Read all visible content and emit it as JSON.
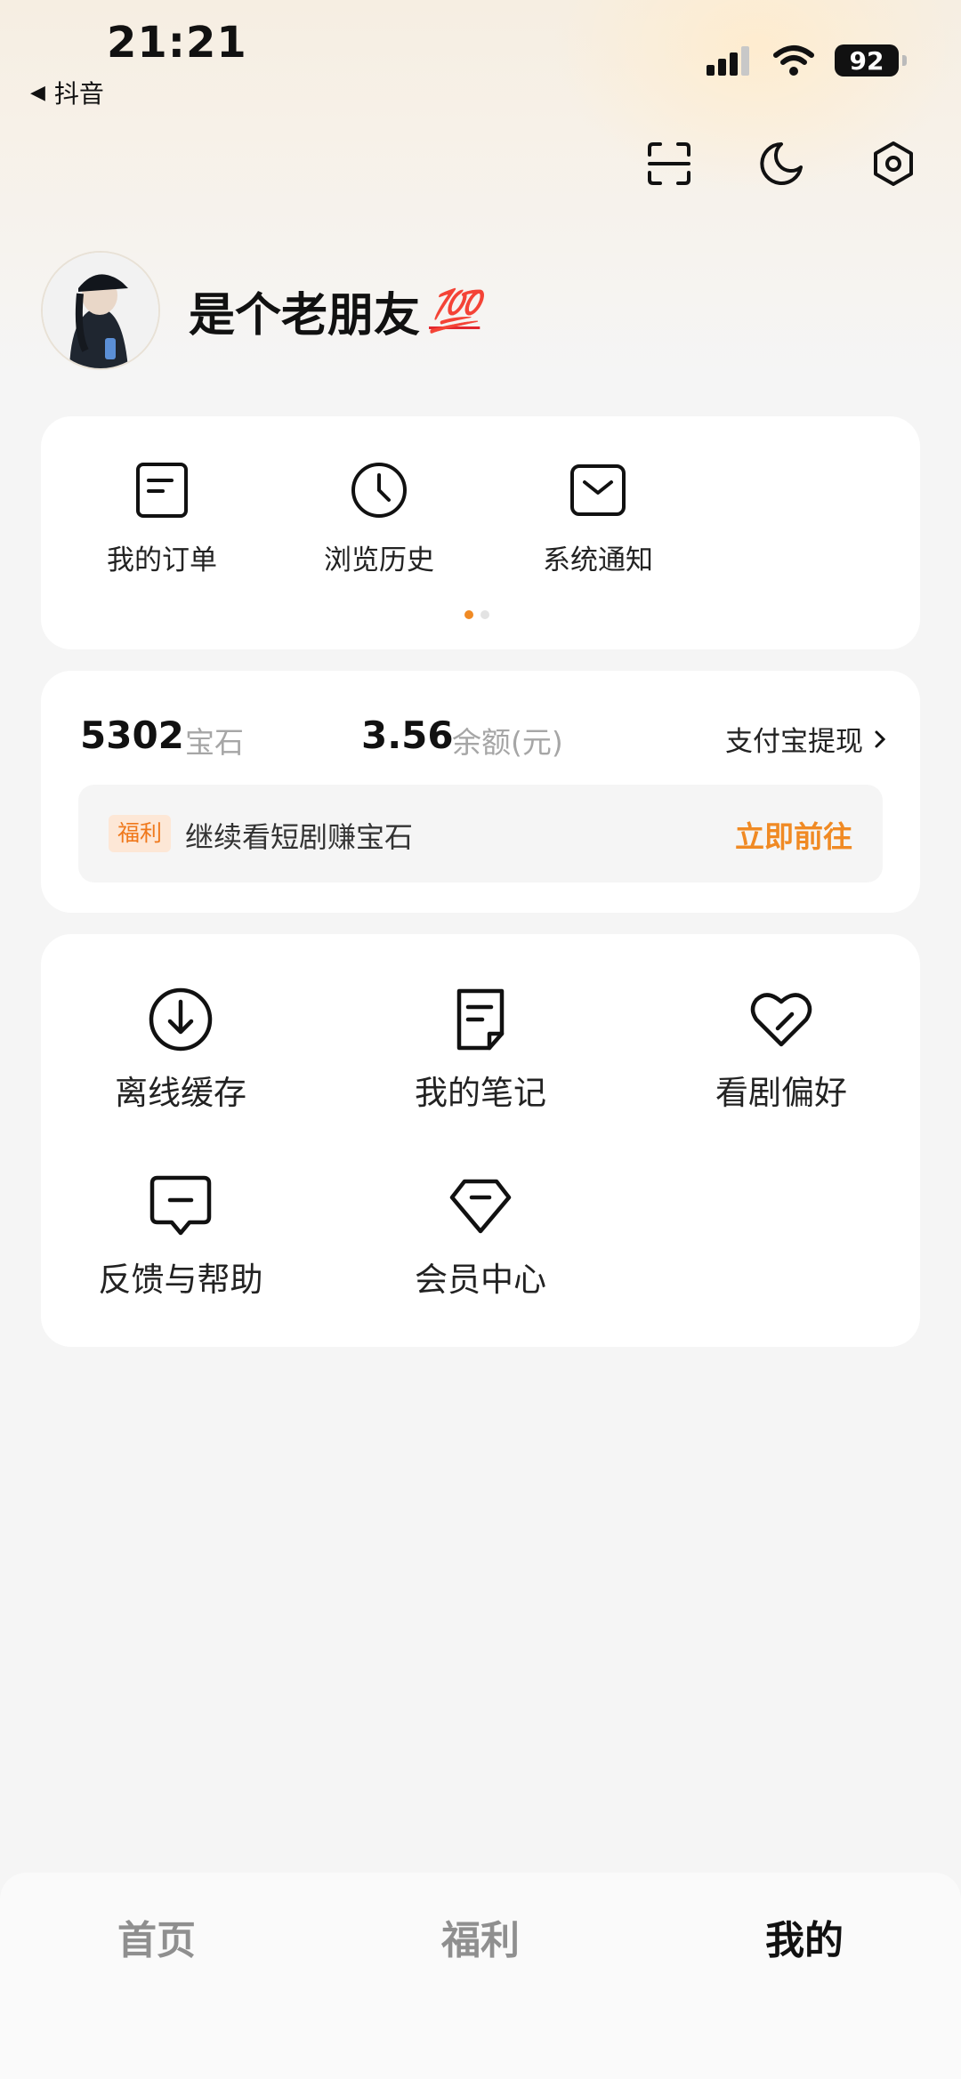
{
  "status_bar": {
    "time": "21:21",
    "back_app": "抖音",
    "battery": "92"
  },
  "header": {
    "icons": [
      "scan-icon",
      "moon-icon",
      "settings-icon"
    ]
  },
  "profile": {
    "username": "是个老朋友",
    "emoji": "💯"
  },
  "quick_entries": [
    {
      "label": "我的订单",
      "icon": "order-icon"
    },
    {
      "label": "浏览历史",
      "icon": "clock-icon"
    },
    {
      "label": "系统通知",
      "icon": "mail-icon"
    }
  ],
  "wallet": {
    "gems_value": "5302",
    "gems_unit": "宝石",
    "balance_value": "3.56",
    "balance_unit": "余额(元)",
    "withdraw_label": "支付宝提现",
    "promo_tag": "福利",
    "promo_text": "继续看短剧赚宝石",
    "promo_action": "立即前往"
  },
  "tools": [
    {
      "label": "离线缓存",
      "icon": "download-icon"
    },
    {
      "label": "我的笔记",
      "icon": "note-icon"
    },
    {
      "label": "看剧偏好",
      "icon": "heart-icon"
    },
    {
      "label": "反馈与帮助",
      "icon": "feedback-icon"
    },
    {
      "label": "会员中心",
      "icon": "diamond-icon"
    }
  ],
  "tabs": [
    {
      "label": "首页",
      "active": false
    },
    {
      "label": "福利",
      "active": false
    },
    {
      "label": "我的",
      "active": true
    }
  ],
  "colors": {
    "accent": "#f08a24",
    "tag_bg": "#fde7d6"
  }
}
